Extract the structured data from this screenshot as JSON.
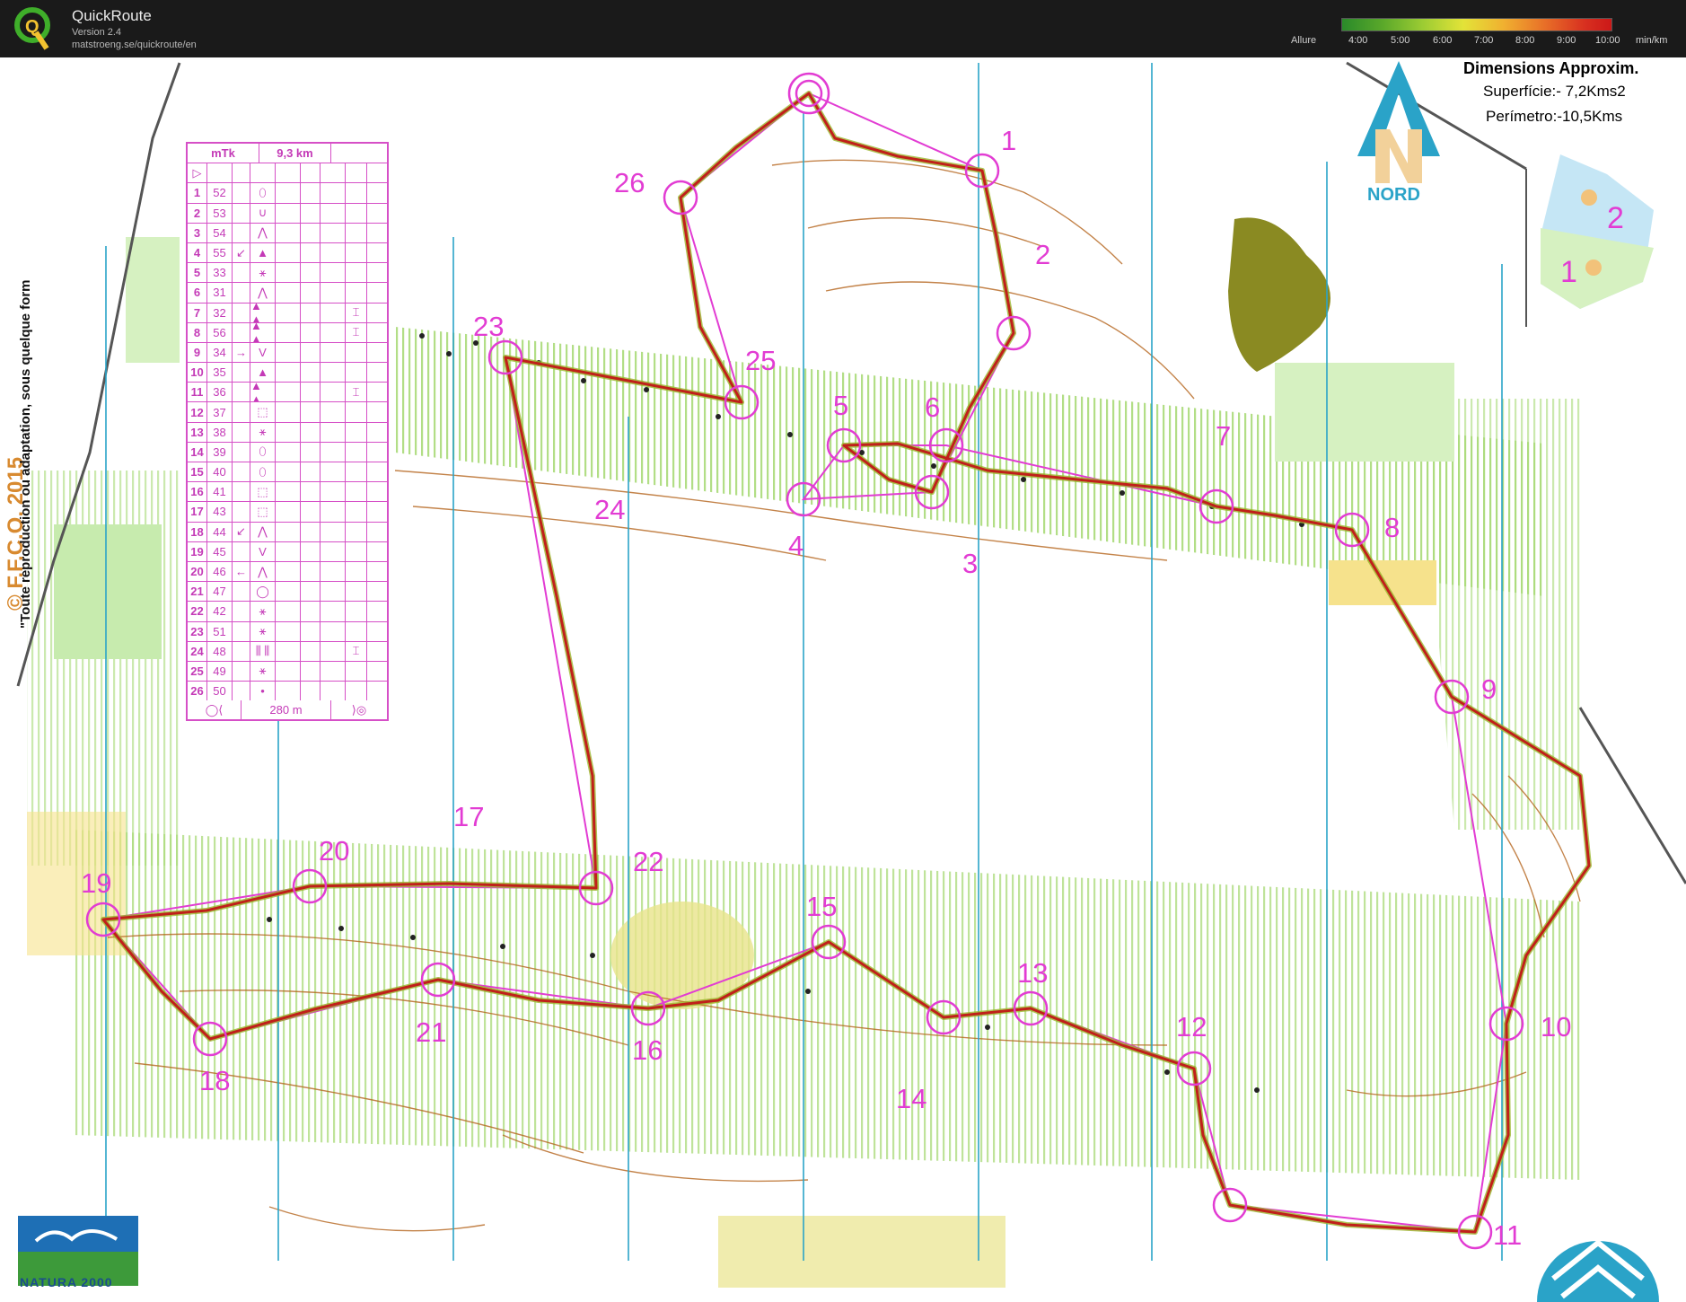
{
  "app": {
    "name": "QuickRoute",
    "version": "Version 2.4",
    "url": "matstroeng.se/quickroute/en"
  },
  "pace_legend": {
    "label": "Allure",
    "ticks": [
      "4:00",
      "5:00",
      "6:00",
      "7:00",
      "8:00",
      "9:00",
      "10:00"
    ],
    "unit": "min/km"
  },
  "map_info": {
    "title": "Dimensions Approxim.",
    "area": "Superfície:- 7,2Kms2",
    "perimeter": "Perímetro:-10,5Kms",
    "north_label": "NORD",
    "inset_zones": [
      "1",
      "2"
    ],
    "copyright": "© F.F.C.O. 2015",
    "reproduction_notice": "\"Toute reproduction ou adaptation, sous quelque form",
    "logo_text": "NATURA 2000"
  },
  "course": {
    "header": [
      "mTk",
      "9,3 km"
    ],
    "footer_distance": "280 m",
    "controls": [
      {
        "n": "1",
        "code": "52",
        "dir": "",
        "feature": "⬯",
        "extra": ""
      },
      {
        "n": "2",
        "code": "53",
        "dir": "",
        "feature": "∪",
        "extra": ""
      },
      {
        "n": "3",
        "code": "54",
        "dir": "",
        "feature": "⋀",
        "extra": ""
      },
      {
        "n": "4",
        "code": "55",
        "dir": "↙",
        "feature": "▲",
        "extra": ""
      },
      {
        "n": "5",
        "code": "33",
        "dir": "",
        "feature": "⚹",
        "extra": ""
      },
      {
        "n": "6",
        "code": "31",
        "dir": "",
        "feature": "⋀",
        "extra": ""
      },
      {
        "n": "7",
        "code": "32",
        "dir": "",
        "feature": "▲ ▲",
        "extra": "⌶"
      },
      {
        "n": "8",
        "code": "56",
        "dir": "",
        "feature": "▲ ▲",
        "extra": "⌶"
      },
      {
        "n": "9",
        "code": "34",
        "dir": "→",
        "feature": "V",
        "extra": ""
      },
      {
        "n": "10",
        "code": "35",
        "dir": "",
        "feature": "▲",
        "extra": ""
      },
      {
        "n": "11",
        "code": "36",
        "dir": "",
        "feature": "▲ ▲",
        "extra": "⌶"
      },
      {
        "n": "12",
        "code": "37",
        "dir": "",
        "feature": "⬚",
        "extra": ""
      },
      {
        "n": "13",
        "code": "38",
        "dir": "",
        "feature": "⚹",
        "extra": ""
      },
      {
        "n": "14",
        "code": "39",
        "dir": "",
        "feature": "⬯",
        "extra": ""
      },
      {
        "n": "15",
        "code": "40",
        "dir": "",
        "feature": "⬯",
        "extra": ""
      },
      {
        "n": "16",
        "code": "41",
        "dir": "",
        "feature": "⬚",
        "extra": ""
      },
      {
        "n": "17",
        "code": "43",
        "dir": "",
        "feature": "⬚",
        "extra": ""
      },
      {
        "n": "18",
        "code": "44",
        "dir": "↙",
        "feature": "⋀",
        "extra": ""
      },
      {
        "n": "19",
        "code": "45",
        "dir": "",
        "feature": "V",
        "extra": ""
      },
      {
        "n": "20",
        "code": "46",
        "dir": "←",
        "feature": "⋀",
        "extra": ""
      },
      {
        "n": "21",
        "code": "47",
        "dir": "",
        "feature": "◯",
        "extra": ""
      },
      {
        "n": "22",
        "code": "42",
        "dir": "",
        "feature": "⚹",
        "extra": ""
      },
      {
        "n": "23",
        "code": "51",
        "dir": "",
        "feature": "⚹",
        "extra": ""
      },
      {
        "n": "24",
        "code": "48",
        "dir": "",
        "feature": "⫼ ⫼",
        "extra": "⌶"
      },
      {
        "n": "25",
        "code": "49",
        "dir": "",
        "feature": "⚹",
        "extra": ""
      },
      {
        "n": "26",
        "code": "50",
        "dir": "",
        "feature": "•",
        "extra": ""
      }
    ]
  },
  "control_labels": [
    "1",
    "2",
    "3",
    "4",
    "5",
    "6",
    "7",
    "8",
    "9",
    "10",
    "11",
    "12",
    "13",
    "14",
    "15",
    "16",
    "17",
    "18",
    "19",
    "20",
    "21",
    "22",
    "23",
    "24",
    "25",
    "26"
  ],
  "colors": {
    "course_magenta": "#e23cd3",
    "route_red": "#c0201a",
    "route_green": "#8fb02a",
    "meridian_blue": "#2aa3c8",
    "contour_brown": "#b5651d",
    "vegetation_green": "#9ed36a",
    "open_yellow": "#f6e28c"
  }
}
